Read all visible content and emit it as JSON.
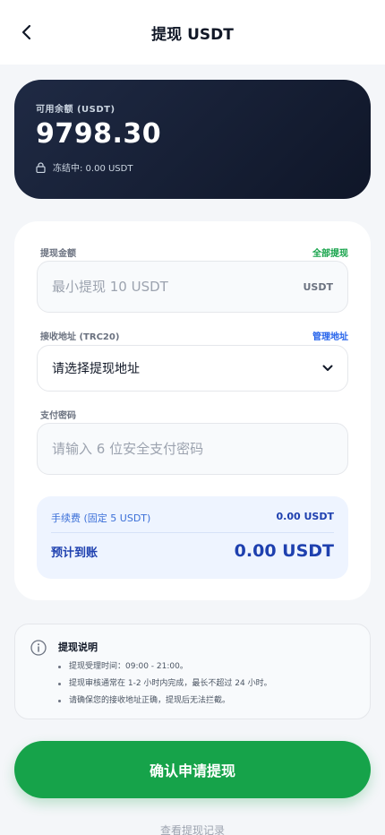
{
  "header": {
    "title": "提现 USDT",
    "back_icon": "chevron-left-icon"
  },
  "balance": {
    "label": "可用余额 (USDT)",
    "amount": "9798.30",
    "frozen_text": "冻结中: 0.00 USDT",
    "lock_icon": "lock-icon"
  },
  "form": {
    "amount": {
      "label": "提现金额",
      "action": "全部提现",
      "placeholder": "最小提现 10 USDT",
      "unit": "USDT"
    },
    "address": {
      "label": "接收地址 (TRC20)",
      "action": "管理地址",
      "selected": "请选择提现地址"
    },
    "password": {
      "label": "支付密码",
      "placeholder": "请输入 6 位安全支付密码"
    },
    "fee": {
      "label": "手续费 (固定 5 USDT)",
      "value": "0.00 USDT",
      "eta_label": "预计到账",
      "eta_value": "0.00 USDT"
    }
  },
  "notes": {
    "title": "提现说明",
    "items": [
      "提现受理时间：09:00 - 21:00。",
      "提现审核通常在 1-2 小时内完成，最长不超过 24 小时。",
      "请确保您的接收地址正确，提现后无法拦截。"
    ]
  },
  "submit_label": "确认申请提现",
  "history_link": "查看提现记录",
  "colors": {
    "accent": "#16a34a",
    "link_blue": "#2563eb",
    "card_dark": "#111827"
  }
}
